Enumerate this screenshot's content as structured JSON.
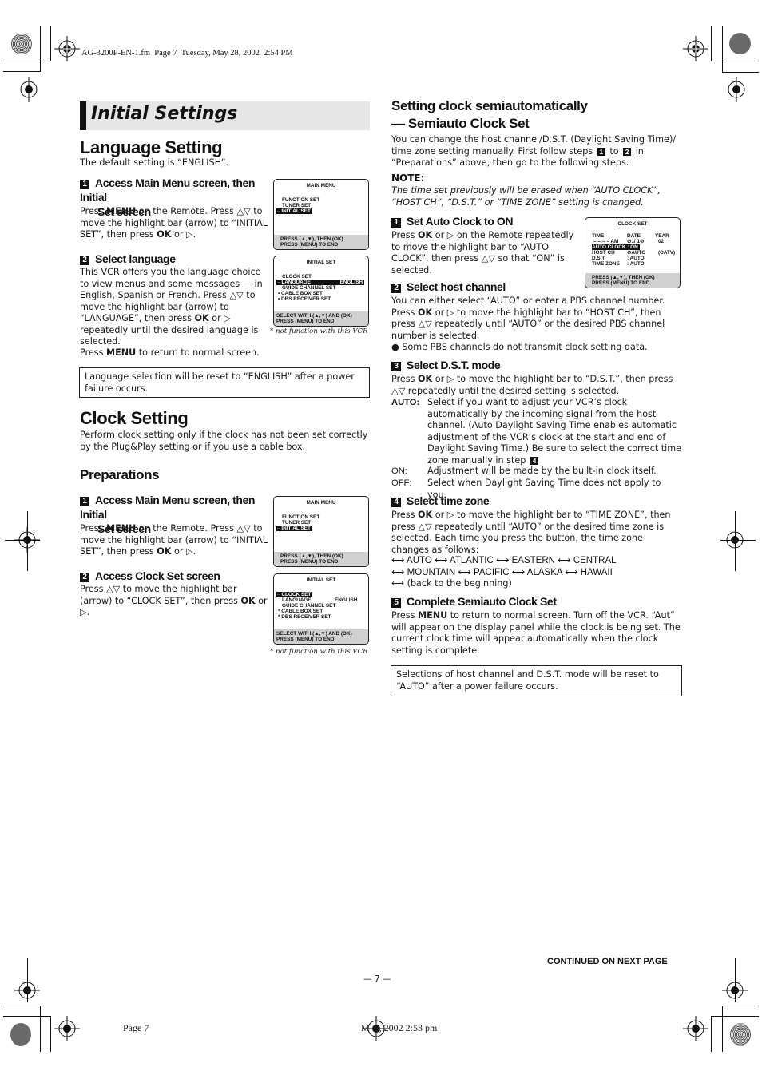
{
  "header": {
    "file_info": "AG-3200P-EN-1.fm  Page 7  Tuesday, May 28, 2002  2:54 PM"
  },
  "page_title": "Initial Settings",
  "language_setting": {
    "heading": "Language Setting",
    "intro": "The default setting is “ENGLISH”.",
    "steps": [
      {
        "number": "1",
        "title_line1": "Access Main Menu screen, then Initial",
        "title_line2": "Set screen",
        "text_parts": [
          "Press ",
          "MENU",
          " on the Remote. Press △▽ to move the highlight bar (arrow) to “INITIAL SET”, then press ",
          "OK",
          " or ▷."
        ]
      },
      {
        "number": "2",
        "title_line1": "Select language",
        "text_parts": [
          "This VCR offers you the language choice to view menus and some messages — in English, Spanish or French. Press △▽ to move the highlight bar (arrow) to “LANGUAGE”, then press ",
          "OK",
          " or ▷ repeatedly until the desired language is selected."
        ],
        "text2_parts": [
          "Press ",
          "MENU",
          " to return to normal screen."
        ]
      }
    ],
    "note_box": "Language selection will be reset to “ENGLISH” after a power failure occurs."
  },
  "osd_main_menu": {
    "title": "MAIN MENU",
    "items": [
      "FUNCTION SET",
      "TUNER SET"
    ],
    "selected": "→INITIAL SET",
    "footer_line1": "PRESS (▲,▼), THEN (OK)",
    "footer_line2": "PRESS (MENU) TO END"
  },
  "osd_initial_set_language": {
    "title": "INITIAL SET",
    "item_clock": "CLOCK SET",
    "selected": "→LANGUAGE",
    "selected_value": "ENGLISH",
    "item_guide": "GUIDE CHANNEL SET",
    "item_cable": "• CABLE BOX SET",
    "item_dbs": "• DBS RECEIVER SET",
    "footer_line1": "SELECT WITH (▲,▼) AND (OK)",
    "footer_line2": "PRESS (MENU) TO END"
  },
  "osd_initial_set_clock": {
    "title": "INITIAL SET",
    "selected": "→CLOCK SET",
    "item_language": "LANGUAGE",
    "item_language_value": "ENGLISH",
    "item_guide": "GUIDE CHANNEL SET",
    "item_cable": "* CABLE BOX SET",
    "item_dbs": "* DBS RECEIVER SET",
    "footer_line1": "SELECT WITH (▲,▼) AND (OK)",
    "footer_line2": "PRESS (MENU) TO END"
  },
  "osd_clock_set": {
    "title": "CLOCK SET",
    "col_time": "TIME",
    "col_date": "DATE",
    "col_year": "YEAR",
    "time_value": "– –:– – AM",
    "date_value": "⊘1/ 1⊘",
    "year_value": "02",
    "selected": "AUTO CLOCK : ON",
    "host_ch_label": "HOST CH",
    "host_ch_value": "⊘AUTO",
    "host_ch_extra": "(CATV)",
    "dst_label": "D.S.T.",
    "dst_value": ": AUTO",
    "tz_label": "TIME ZONE",
    "tz_value": ": AUTO",
    "footer_line1": "PRESS (▲,▼), THEN (OK)",
    "footer_line2": "PRESS (MENU) TO END"
  },
  "osd_footnote": "* not function with this VCR",
  "clock_setting": {
    "heading": "Clock Setting",
    "intro": "Perform clock setting only if the clock has not been set correctly by the Plug&Play setting or if you use a cable box.",
    "preparations_heading": "Preparations",
    "steps": [
      {
        "number": "1",
        "title_line1": "Access Main Menu screen, then Initial",
        "title_line2": "Set screen",
        "text_parts": [
          "Press ",
          "MENU",
          " on the Remote. Press △▽ to move the highlight bar (arrow) to “INITIAL SET”, then press ",
          "OK",
          " or ▷."
        ]
      },
      {
        "number": "2",
        "title_line1": "Access Clock Set screen",
        "text_parts": [
          "Press △▽ to move the highlight bar (arrow) to “CLOCK SET”, then press ",
          "OK",
          " or ▷."
        ]
      }
    ]
  },
  "semiauto": {
    "heading_line1": "Setting clock semiautomatically",
    "heading_line2": "— Semiauto Clock Set",
    "intro_a": "You can change the host channel/D.S.T. (Daylight Saving Time)/ time zone setting manually. First follow steps ",
    "intro_step_a": "1",
    "intro_b": " to ",
    "intro_step_b": "2",
    "intro_c": " in “Preparations” above, then go to the following steps.",
    "note_label": "NOTE:",
    "note_text": "The time set previously will be erased when “AUTO CLOCK”, “HOST CH”, “D.S.T.” or “TIME ZONE” setting is changed.",
    "steps": [
      {
        "number": "1",
        "title": "Set Auto Clock to ON",
        "text_parts": [
          "Press ",
          "OK",
          " or ▷ on the Remote repeatedly to move the highlight bar to “AUTO CLOCK”, then press △▽ so that “ON” is selected."
        ]
      },
      {
        "number": "2",
        "title": "Select host channel",
        "text_parts": [
          "You can either select “AUTO” or enter a PBS channel number. Press ",
          "OK",
          " or ▷ to move the highlight bar to “HOST CH”, then press △▽ repeatedly until “AUTO” or the desired PBS channel number is selected."
        ],
        "bullet": "● Some PBS channels do not transmit clock setting data."
      },
      {
        "number": "3",
        "title": "Select D.S.T. mode",
        "text_parts": [
          "Press ",
          "OK",
          " or ▷ to move the highlight bar to “D.S.T.”, then press △▽ repeatedly until the desired setting is selected."
        ],
        "options": [
          {
            "label": "AUTO",
            "sep": ":",
            "text": "Select if you want to adjust your VCR’s clock automatically by the incoming signal from the host channel. (Auto Daylight Saving Time enables automatic adjustment of the VCR’s clock at the start and end of Daylight Saving Time.) Be sure to select the correct time zone manually in step ",
            "step_ref": "4"
          },
          {
            "label": "ON:",
            "sep": "",
            "text": "Adjustment will be made by the built-in clock itself."
          },
          {
            "label": "OFF:",
            "sep": "",
            "text": "Select when Daylight Saving Time does not apply to you."
          }
        ]
      },
      {
        "number": "4",
        "title": "Select time zone",
        "text_parts": [
          "Press ",
          "OK",
          " or ▷ to move the highlight bar to “TIME ZONE”, then press △▽ repeatedly until “AUTO” or the desired time zone is selected. Each time you press the button, the time zone changes as follows:"
        ],
        "zones_line1": "⟷ AUTO ⟷ ATLANTIC ⟷ EASTERN ⟷ CENTRAL",
        "zones_line2": "⟷ MOUNTAIN ⟷ PACIFIC ⟷ ALASKA ⟷ HAWAII",
        "zones_line3": "⟷ (back to the beginning)"
      },
      {
        "number": "5",
        "title": "Complete Semiauto Clock Set",
        "text_parts": [
          "Press ",
          "MENU",
          " to return to normal screen. Turn off the VCR. “Aut” will appear on the display panel while the clock is being set. The current clock time will appear automatically when the clock setting is complete."
        ]
      }
    ],
    "note_box": "Selections of host channel and D.S.T. mode will be reset to “AUTO” after a power failure occurs."
  },
  "footer": {
    "continued": "CONTINUED ON NEXT PAGE",
    "page_number": "— 7 —",
    "page_label": "Page 7",
    "print_time": "M  8, 2002 2:53 pm"
  }
}
